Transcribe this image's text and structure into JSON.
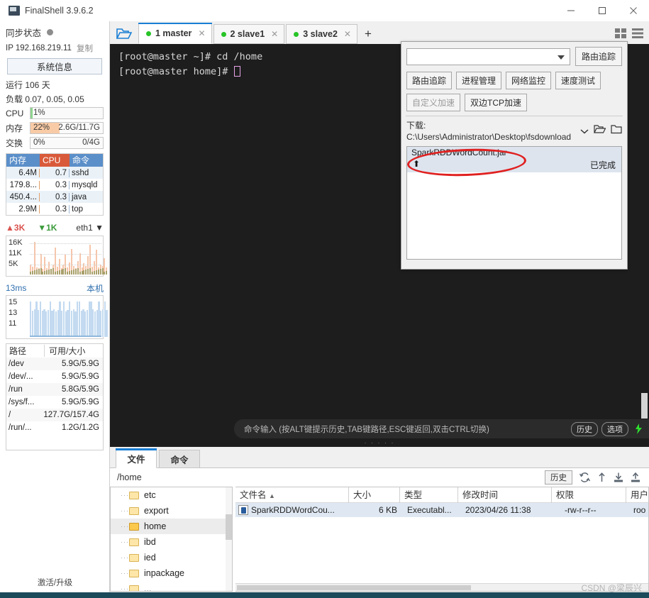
{
  "window": {
    "title": "FinalShell 3.9.6.2",
    "icon": "app-icon",
    "minimize": "─",
    "maximize": "□",
    "close": "✕"
  },
  "sidebar": {
    "sync_label": "同步状态",
    "ip_label": "IP 192.168.219.11",
    "copy_label": "复制",
    "sysinfo_button": "系统信息",
    "uptime": "运行 106 天",
    "load": "负载 0.07, 0.05, 0.05",
    "meters": [
      {
        "label": "CPU",
        "percent": "1%",
        "right": "",
        "fill_pct": 3,
        "color": "#8fd48f"
      },
      {
        "label": "内存",
        "percent": "22%",
        "right": "2.6G/11.7G",
        "fill_pct": 40,
        "color": "#f8cba6"
      },
      {
        "label": "交换",
        "percent": "0%",
        "right": "0/4G",
        "fill_pct": 0,
        "color": "#cfe6cf"
      }
    ],
    "proc_table": {
      "headers": [
        "内存",
        "CPU",
        "命令"
      ],
      "rows": [
        {
          "mem": "6.4M",
          "cpu": "0.7",
          "cmd": "sshd"
        },
        {
          "mem": "179.8...",
          "cpu": "0.3",
          "cmd": "mysqld"
        },
        {
          "mem": "450.4...",
          "cpu": "0.3",
          "cmd": "java"
        },
        {
          "mem": "2.9M",
          "cpu": "0.3",
          "cmd": "top"
        }
      ]
    },
    "network": {
      "upload": "3K",
      "download": "1K",
      "interface": "eth1",
      "axis": [
        "16K",
        "11K",
        "5K"
      ]
    },
    "ping": {
      "latency": "13ms",
      "host": "本机",
      "axis": [
        "15",
        "13",
        "11"
      ]
    },
    "disk_table": {
      "headers": [
        "路径",
        "可用/大小"
      ],
      "rows": [
        {
          "path": "/dev",
          "size": "5.9G/5.9G"
        },
        {
          "path": "/dev/...",
          "size": "5.9G/5.9G"
        },
        {
          "path": "/run",
          "size": "5.8G/5.9G"
        },
        {
          "path": "/sys/f...",
          "size": "5.9G/5.9G"
        },
        {
          "path": "/",
          "size": "127.7G/157.4G"
        },
        {
          "path": "/run/...",
          "size": "1.2G/1.2G"
        }
      ]
    },
    "activate_label": "激活/升级"
  },
  "tabbar": {
    "folder_icon": "open-folder-icon",
    "tabs": [
      {
        "label": "1 master",
        "active": true
      },
      {
        "label": "2 slave1",
        "active": false
      },
      {
        "label": "3 slave2",
        "active": false
      }
    ],
    "add_label": "+",
    "grid_icon": "grid-view-icon",
    "list_icon": "list-view-icon"
  },
  "terminal": {
    "lines": [
      "[root@master ~]# cd /home",
      "[root@master home]# "
    ],
    "command_placeholder": "命令输入 (按ALT键提示历史,TAB键路径,ESC键返回,双击CTRL切换)",
    "history_button": "历史",
    "options_button": "选项",
    "icons": [
      "bolt-icon",
      "copy-icon",
      "paste-icon",
      "search-icon",
      "gear-icon",
      "download-icon",
      "window-icon"
    ]
  },
  "right_panel": {
    "combo_value": "",
    "trace_button": "路由追踪",
    "buttons_row1": [
      "路由追踪",
      "进程管理",
      "网络监控",
      "速度测试"
    ],
    "buttons_row2": [
      "自定义加速",
      "双边TCP加速"
    ],
    "download_label": "下载: C:\\Users\\Administrator\\Desktop\\fsdownload",
    "download_item": {
      "filename": "SparkRDDWordCount.jar",
      "status": "已完成"
    },
    "annotation_color": "#e02020"
  },
  "bottom_panel": {
    "tabs": [
      {
        "label": "文件",
        "active": true
      },
      {
        "label": "命令",
        "active": false
      }
    ],
    "path": "/home",
    "history_button": "历史",
    "toolbar_icons": [
      "refresh-icon",
      "upload-icon",
      "download-file-icon",
      "upload-file-icon"
    ],
    "tree": [
      {
        "label": "etc",
        "selected": false,
        "open": false
      },
      {
        "label": "export",
        "selected": false,
        "open": false
      },
      {
        "label": "home",
        "selected": true,
        "open": true
      },
      {
        "label": "ibd",
        "selected": false,
        "open": false
      },
      {
        "label": "ied",
        "selected": false,
        "open": false
      },
      {
        "label": "inpackage",
        "selected": false,
        "open": false
      },
      {
        "label": "...",
        "selected": false,
        "open": false
      }
    ],
    "file_list": {
      "headers": [
        "文件名",
        "大小",
        "类型",
        "修改时间",
        "权限",
        "用户"
      ],
      "sort_indicator": "▲",
      "rows": [
        {
          "name": "SparkRDDWordCou...",
          "size": "6 KB",
          "type": "Executabl...",
          "modified": "2023/04/26 11:38",
          "perm": "-rw-r--r--",
          "user": "roo"
        }
      ]
    }
  },
  "watermark": "CSDN @梁辰兴"
}
